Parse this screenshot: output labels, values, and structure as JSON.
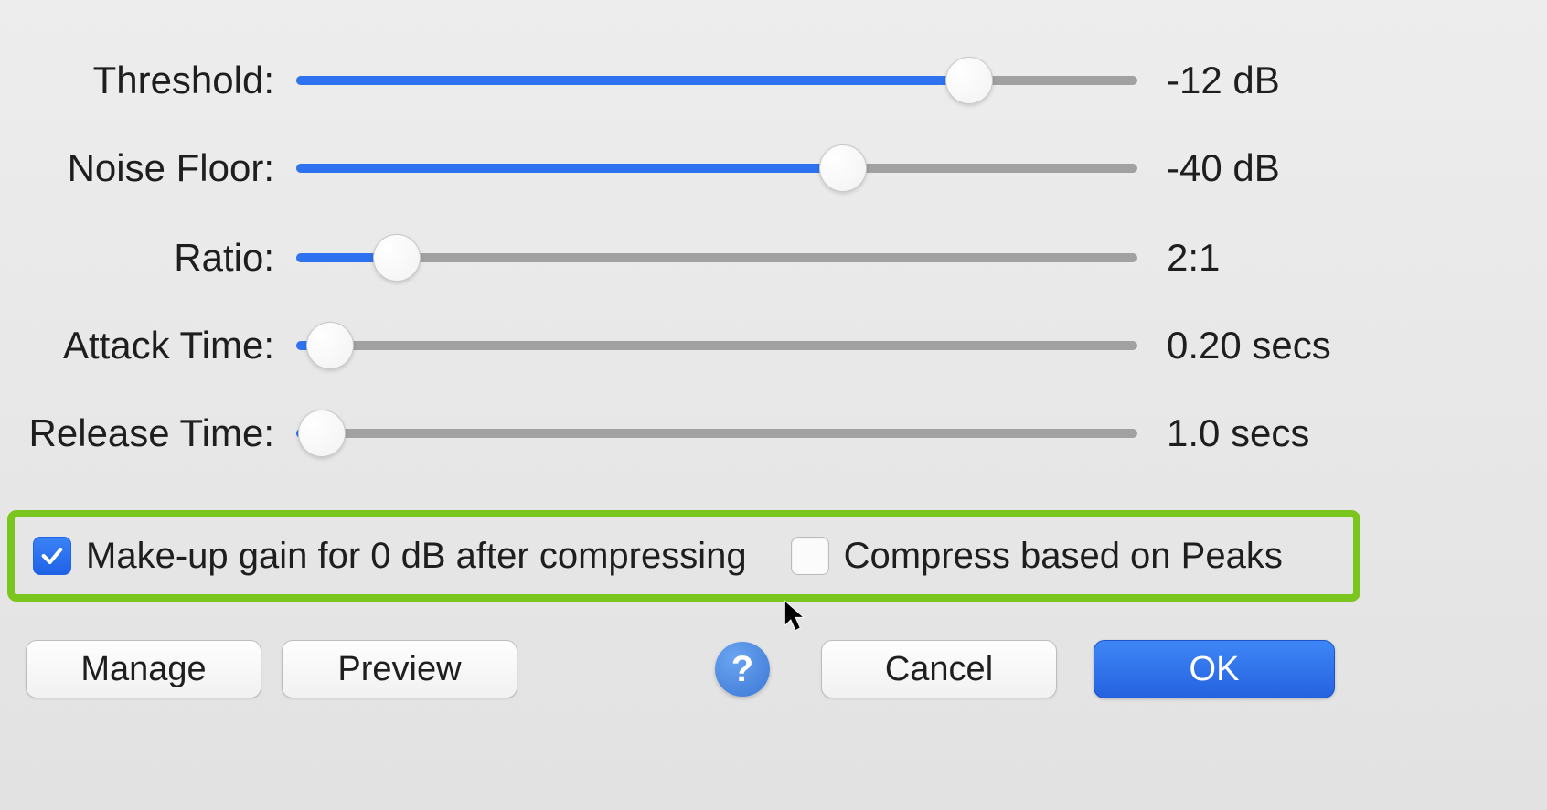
{
  "sliders": {
    "threshold": {
      "label": "Threshold:",
      "value": "-12 dB",
      "percent": 80
    },
    "noise_floor": {
      "label": "Noise Floor:",
      "value": "-40 dB",
      "percent": 65
    },
    "ratio": {
      "label": "Ratio:",
      "value": "2:1",
      "percent": 12
    },
    "attack_time": {
      "label": "Attack Time:",
      "value": "0.20 secs",
      "percent": 4
    },
    "release_time": {
      "label": "Release Time:",
      "value": "1.0 secs",
      "percent": 3
    }
  },
  "checkboxes": {
    "makeup_gain": {
      "label": "Make-up gain for 0 dB after compressing",
      "checked": true
    },
    "peaks": {
      "label": "Compress based on Peaks",
      "checked": false
    }
  },
  "buttons": {
    "manage": "Manage",
    "preview": "Preview",
    "cancel": "Cancel",
    "ok": "OK"
  },
  "help": "?",
  "colors": {
    "accent": "#2f72ef",
    "highlight": "#7bc61e"
  }
}
